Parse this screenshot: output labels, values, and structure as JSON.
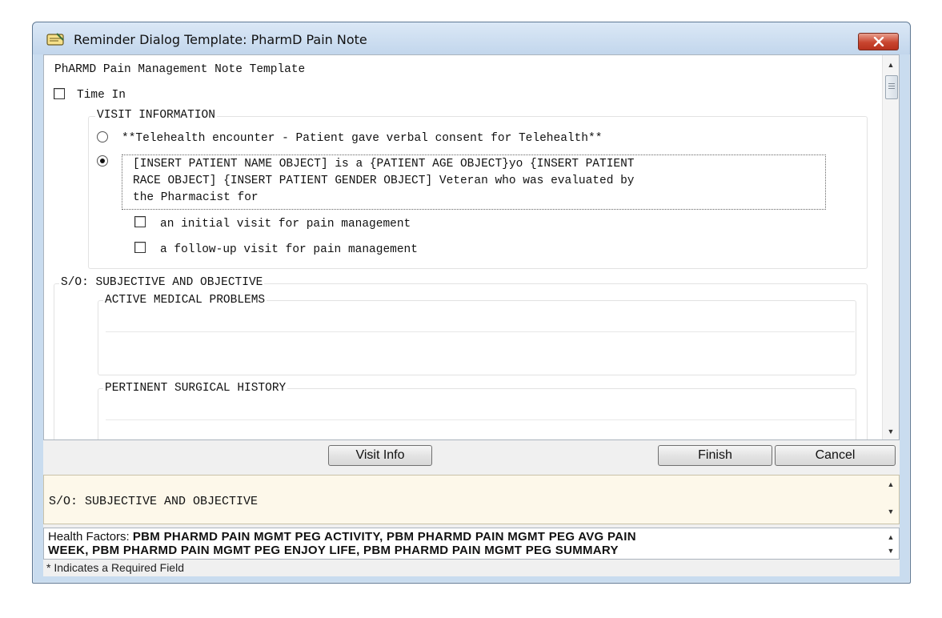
{
  "window": {
    "title": "Reminder Dialog Template: PharmD Pain Note",
    "close_icon": "close-icon"
  },
  "template": {
    "heading": "PhARMD Pain Management Note Template",
    "time_in": {
      "label": "Time In",
      "checked": false
    },
    "visit_information": {
      "legend": "VISIT INFORMATION",
      "telehealth": {
        "label": "**Telehealth encounter - Patient gave verbal consent for Telehealth**",
        "selected": false
      },
      "patient_intro": {
        "selected": true,
        "line1": "[INSERT PATIENT NAME OBJECT] is a {PATIENT AGE OBJECT}yo {INSERT PATIENT",
        "line2": "RACE OBJECT] {INSERT PATIENT GENDER OBJECT] Veteran who was evaluated by",
        "line3": "the Pharmacist for"
      },
      "initial_visit": {
        "label": "an initial visit for pain management",
        "checked": false
      },
      "followup_visit": {
        "label": "a follow-up visit for pain management",
        "checked": false
      }
    },
    "subjective_objective": {
      "legend": "S/O: SUBJECTIVE AND OBJECTIVE",
      "active_problems": {
        "legend": "ACTIVE MEDICAL PROBLEMS",
        "value": ""
      },
      "surgical_history": {
        "legend": "PERTINENT SURGICAL HISTORY",
        "value": ""
      }
    }
  },
  "buttons": {
    "visit_info": "Visit Info",
    "finish": "Finish",
    "cancel": "Cancel"
  },
  "hint_panel": {
    "text": "S/O: SUBJECTIVE AND OBJECTIVE"
  },
  "health_factors": {
    "label": "Health Factors: ",
    "line1": "PBM PHARMD PAIN MGMT PEG ACTIVITY, PBM PHARMD PAIN MGMT PEG AVG PAIN",
    "line2": "WEEK, PBM PHARMD PAIN MGMT PEG ENJOY LIFE, PBM PHARMD PAIN MGMT PEG SUMMARY"
  },
  "status": {
    "required_note": "* Indicates a Required Field"
  }
}
